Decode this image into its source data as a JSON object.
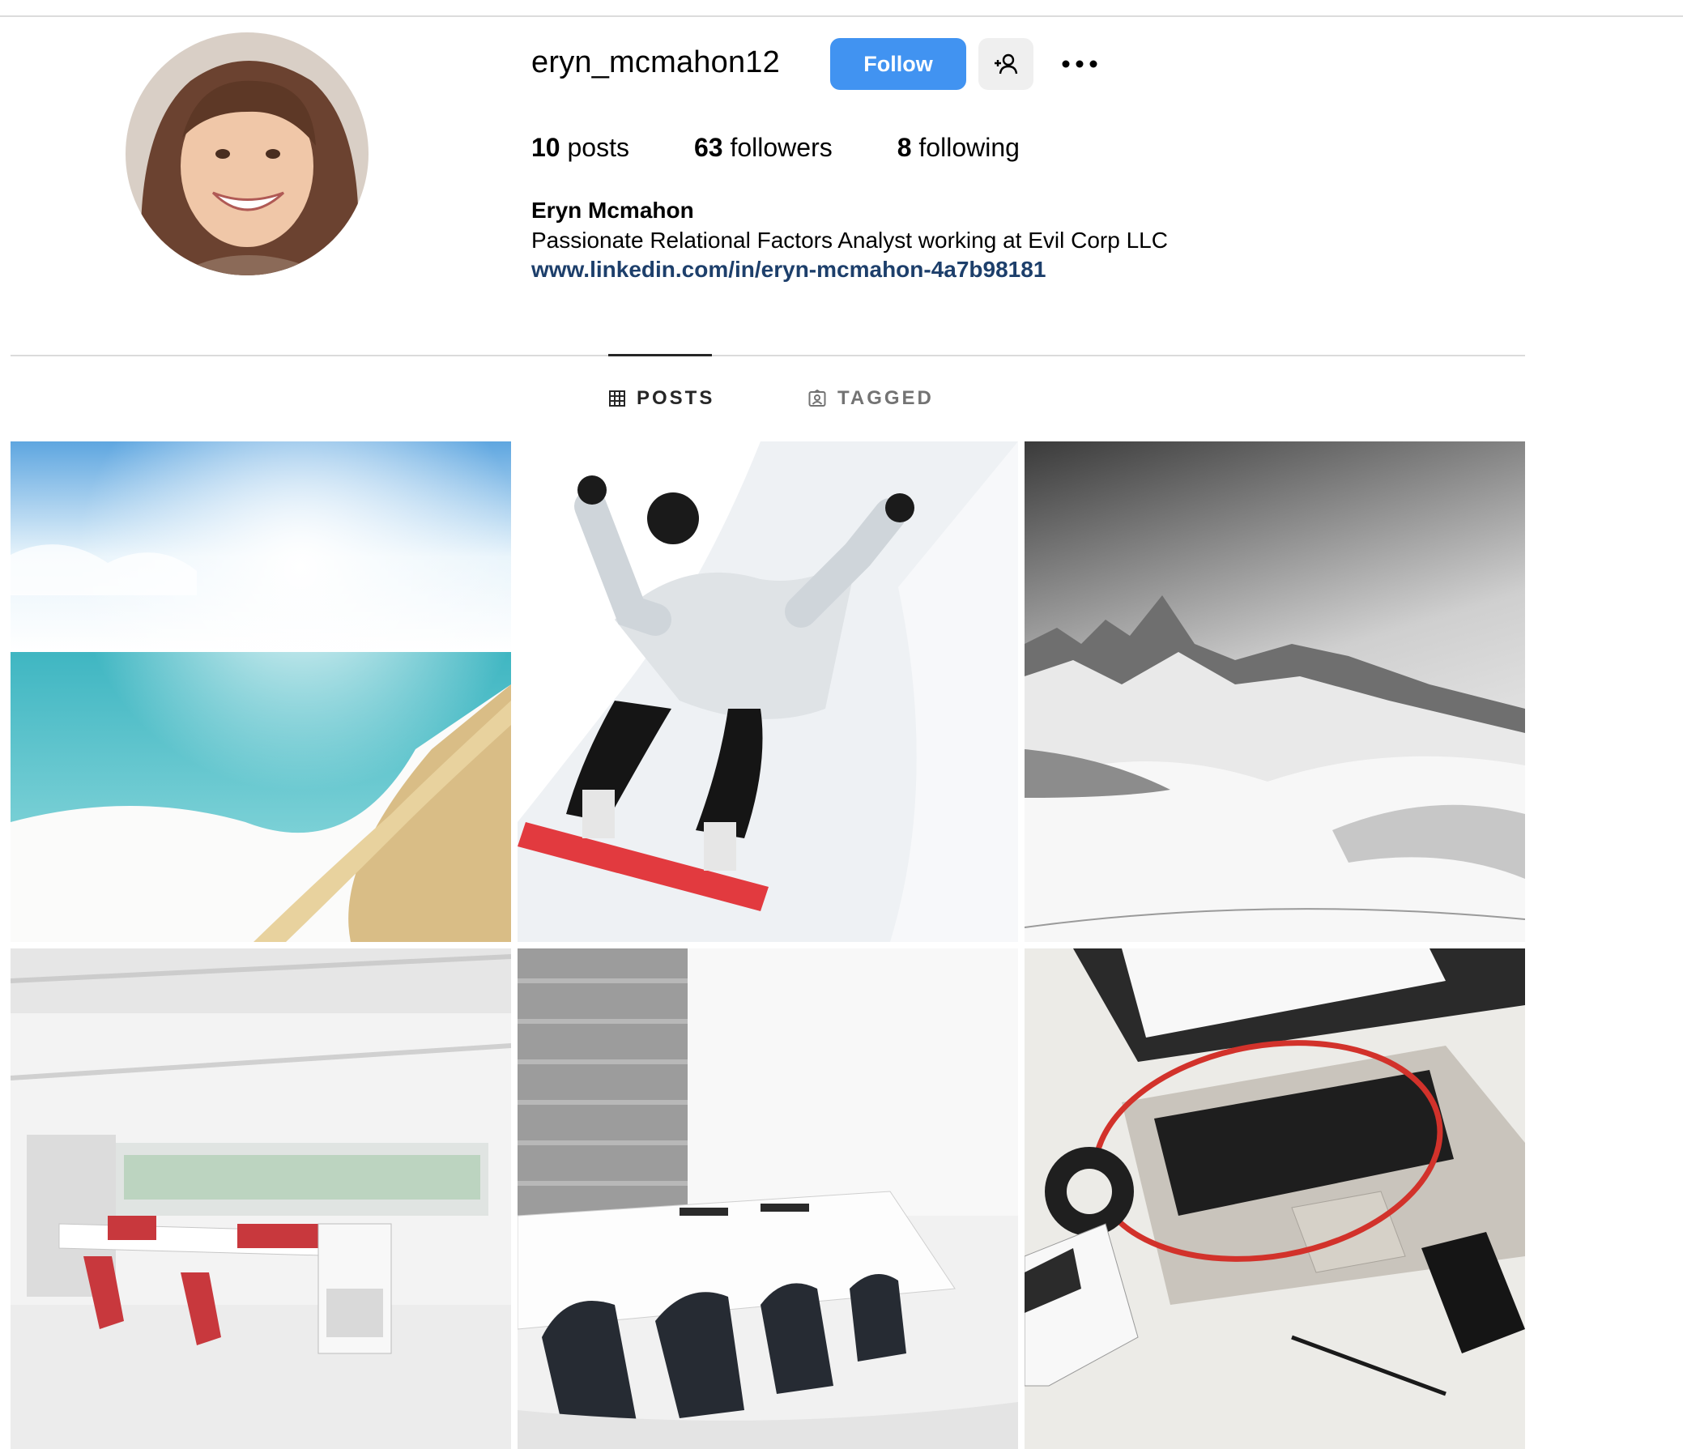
{
  "profile": {
    "username": "eryn_mcmahon12",
    "follow_label": "Follow",
    "full_name": "Eryn Mcmahon",
    "bio": "Passionate Relational Factors Analyst working at Evil Corp LLC",
    "link": "www.linkedin.com/in/eryn-mcmahon-4a7b98181"
  },
  "stats": {
    "posts_count": "10",
    "posts_label": "posts",
    "followers_count": "63",
    "followers_label": "followers",
    "following_count": "8",
    "following_label": "following"
  },
  "tabs": [
    {
      "label": "POSTS",
      "icon": "grid-icon",
      "active": true
    },
    {
      "label": "TAGGED",
      "icon": "tagged-icon",
      "active": false
    }
  ],
  "posts": [
    {
      "subject": "beach-photo"
    },
    {
      "subject": "snow-angel-snowboarder-photo"
    },
    {
      "subject": "snowy-mountains-photo"
    },
    {
      "subject": "open-office-photo"
    },
    {
      "subject": "conference-room-photo"
    },
    {
      "subject": "laptop-desk-photo"
    }
  ],
  "colors": {
    "follow_button": "#4193f1",
    "link": "#1d3f6b",
    "secondary_button": "#efefef"
  }
}
